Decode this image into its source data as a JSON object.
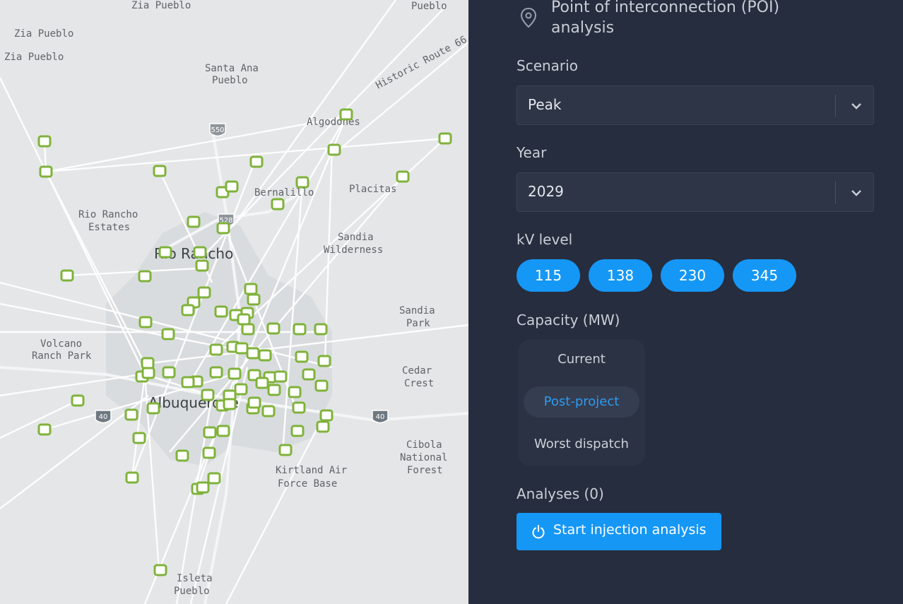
{
  "map": {
    "labels": [
      "Zia Pueblo",
      "Zia Pueblo",
      "Zia Pueblo",
      "Pueblo",
      "Santa Ana",
      "Pueblo",
      "Historic Route 66",
      "Algodones",
      "Bernalillo",
      "Placitas",
      "Rio Rancho",
      "Estates",
      "Sandia",
      "Wilderness",
      "Sandia",
      "Park",
      "Volcano",
      "Ranch Park",
      "Cedar",
      "Crest",
      "Cibola",
      "National",
      "Forest",
      "Kirtland Air",
      "Force Base",
      "Isleta",
      "Pueblo"
    ],
    "city_labels": [
      "Rio Rancho",
      "Albuquerque"
    ],
    "shields": [
      "550",
      "528",
      "40",
      "40"
    ],
    "colors": {
      "land": "#e4e6e7",
      "lines": "#ffffff",
      "node_ring": "#7fb23a",
      "node_fill": "#ffffff"
    }
  },
  "panel": {
    "title": "Point of interconnection (POI) analysis",
    "scenario": {
      "label": "Scenario",
      "value": "Peak"
    },
    "year": {
      "label": "Year",
      "value": "2029"
    },
    "kv": {
      "label": "kV level",
      "options": [
        "115",
        "138",
        "230",
        "345"
      ]
    },
    "capacity": {
      "label": "Capacity (MW)",
      "options": [
        "Current",
        "Post-project",
        "Worst dispatch"
      ],
      "selected": "Post-project"
    },
    "analyses": {
      "label": "Analyses (0)"
    },
    "start_button": "Start injection analysis",
    "colors": {
      "accent": "#1597f6",
      "panel_bg": "#262d3e"
    }
  }
}
